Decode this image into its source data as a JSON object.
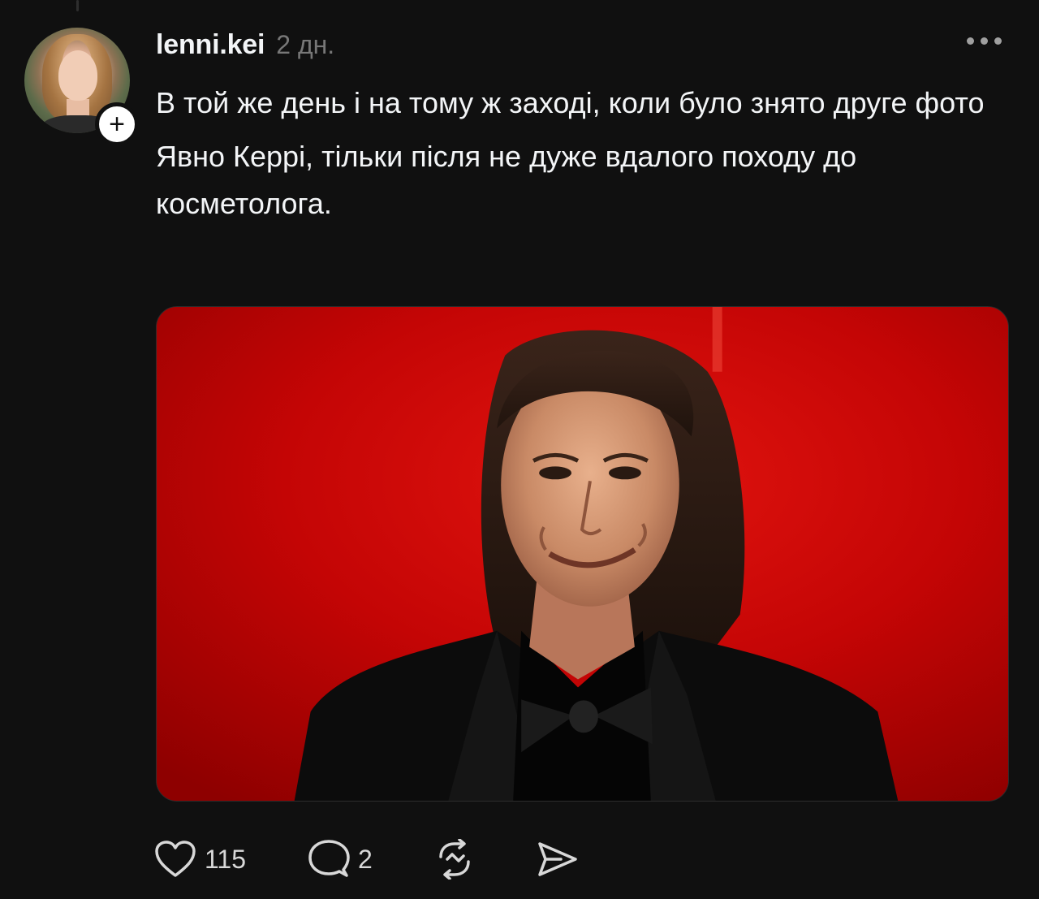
{
  "post": {
    "username": "lenni.kei",
    "timestamp": "2 дн.",
    "follow_symbol": "+",
    "text_paragraphs": [
      "В той же день і на тому ж заході, коли було знято друге фото",
      "Явно Керрі, тільки після не дуже вдалого походу до косметолога."
    ]
  },
  "actions": {
    "like_count": "115",
    "comment_count": "2",
    "icons": [
      "heart-icon",
      "comment-icon",
      "repost-icon",
      "share-icon"
    ]
  },
  "colors": {
    "background": "#101010",
    "text": "#f3f5f7",
    "muted": "#777777",
    "media_red": "#c80404"
  }
}
